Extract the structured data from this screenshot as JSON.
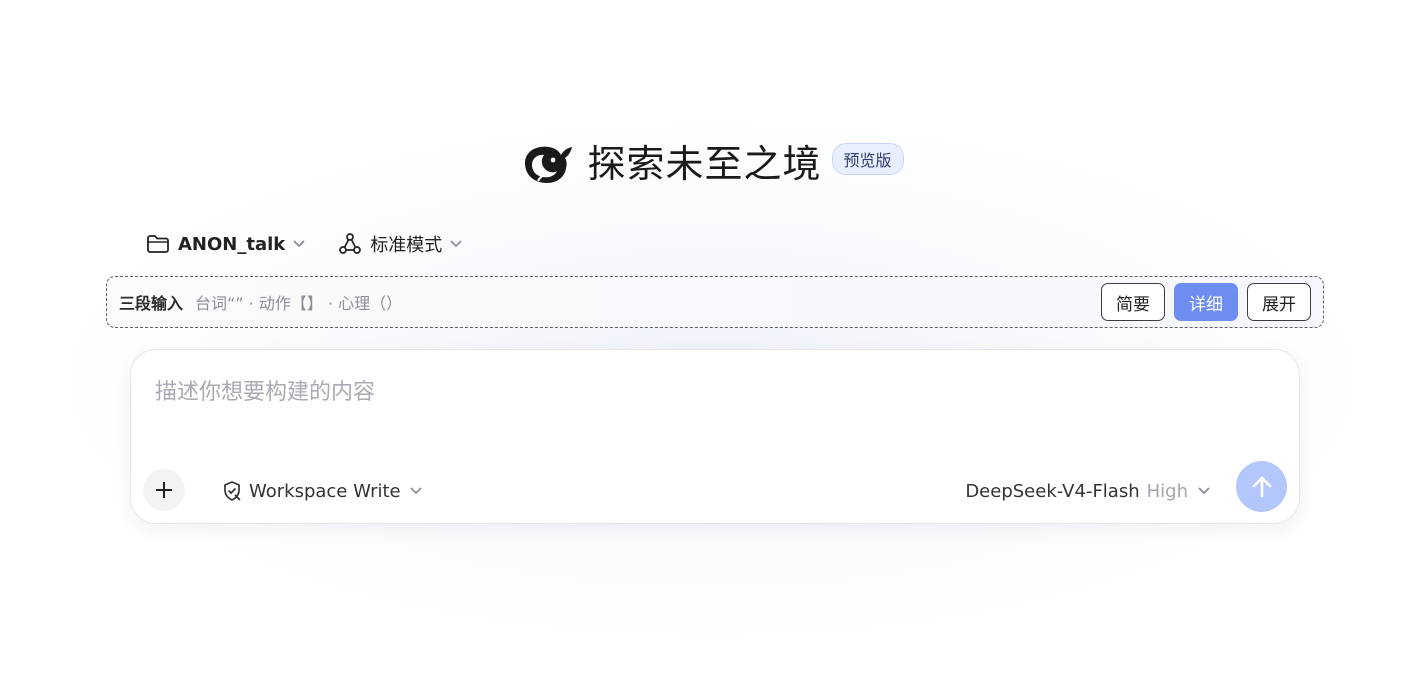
{
  "hero": {
    "title": "探索未至之境",
    "badge": "预览版",
    "logo_icon": "whale-logo-icon"
  },
  "toolbar": {
    "project": {
      "label": "ANON_talk",
      "icon": "folder-icon"
    },
    "mode": {
      "label": "标准模式",
      "icon": "nodes-icon"
    }
  },
  "three_stage": {
    "label": "三段输入",
    "hint": "台词“” · 动作【】 · 心理（）",
    "buttons": [
      {
        "label": "简要",
        "active": false
      },
      {
        "label": "详细",
        "active": true
      },
      {
        "label": "展开",
        "active": false
      }
    ]
  },
  "composer": {
    "placeholder": "描述你想要构建的内容",
    "value": "",
    "permission": "Workspace Write",
    "model": "DeepSeek-V4-Flash",
    "effort": "High"
  },
  "colors": {
    "accent": "#6d8df0",
    "send_disabled": "#b3c7fb",
    "badge_bg": "#e8efff"
  }
}
